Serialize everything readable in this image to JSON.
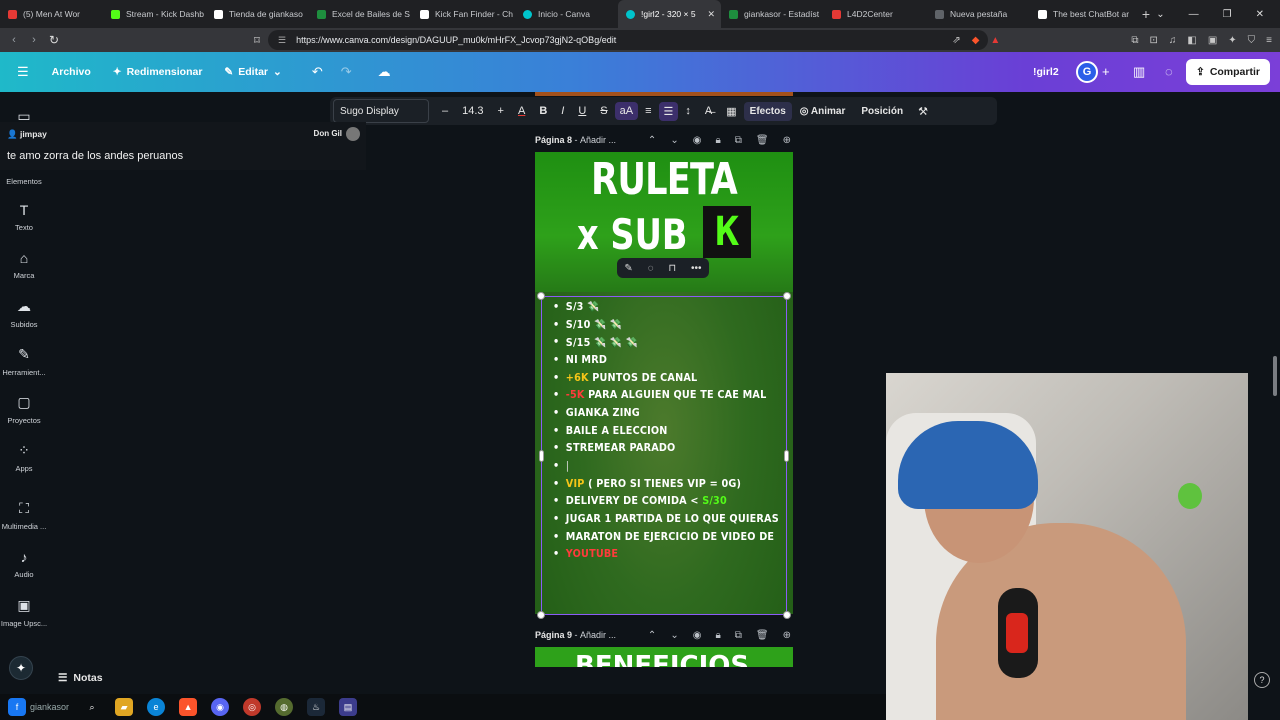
{
  "browser": {
    "tabs": [
      {
        "label": "(5) Men At Wor",
        "color": "#e53935"
      },
      {
        "label": "Stream - Kick Dashb",
        "color": "#53fc18"
      },
      {
        "label": "Tienda de giankaso",
        "color": "#ffffff"
      },
      {
        "label": "Excel de Bailes de S",
        "color": "#1e8e3e"
      },
      {
        "label": "Kick Fan Finder - Ch",
        "color": "#ffffff"
      },
      {
        "label": "Inicio - Canva",
        "color": "#00c4cc"
      },
      {
        "label": "!girl2 - 320 × 5",
        "color": "#00c4cc",
        "active": true
      },
      {
        "label": "giankasor - Estadíst",
        "color": "#1e8e3e"
      },
      {
        "label": "L4D2Center",
        "color": "#e53935"
      },
      {
        "label": "Nueva pestaña",
        "color": "#5f6368"
      },
      {
        "label": "The best ChatBot ar",
        "color": "#ffffff"
      }
    ],
    "url": "https://www.canva.com/design/DAGUUP_mu0k/mHrFX_Jcvop73gjN2-qOBg/edit"
  },
  "canva_header": {
    "archivo": "Archivo",
    "redimensionar": "Redimensionar",
    "editar": "Editar",
    "design_name": "!girl2",
    "avatar": "G",
    "share": "Compartir"
  },
  "toolbar": {
    "font": "Sugo Display",
    "font_size": "14.3",
    "efectos": "Efectos",
    "animar": "Animar",
    "posicion": "Posición"
  },
  "sidebar": {
    "items": [
      {
        "label": "Elementos",
        "icon": "shapes-icon"
      },
      {
        "label": "Texto",
        "icon": "text-icon"
      },
      {
        "label": "Marca",
        "icon": "brand-icon"
      },
      {
        "label": "Subidos",
        "icon": "upload-icon"
      },
      {
        "label": "Herramient...",
        "icon": "draw-icon"
      },
      {
        "label": "Proyectos",
        "icon": "folder-icon"
      },
      {
        "label": "Apps",
        "icon": "apps-icon"
      },
      {
        "label": "Multimedia ...",
        "icon": "media-icon"
      },
      {
        "label": "Audio",
        "icon": "audio-icon"
      },
      {
        "label": "Image Upsc...",
        "icon": "image-icon"
      }
    ]
  },
  "chat": {
    "user": "jimpay",
    "streamer": "Don Gil",
    "message": "te amo zorra de los andes peruanos"
  },
  "pages": {
    "page8_label": "Página 8",
    "page8_add": "Añadir ...",
    "page9_label": "Página 9",
    "page9_add": "Añadir ...",
    "page9_title": "BENEFICIOS"
  },
  "design": {
    "title_line1": "RULETA",
    "title_line2": "x SUB",
    "logo_letter": "K",
    "list": {
      "i1": "S/3 💸",
      "i2": "S/10 💸 💸",
      "i3": "S/15 💸 💸 💸",
      "i4": "NI MRD",
      "i5a": "+6K",
      "i5b": " PUNTOS DE CANAL",
      "i6a": "-5K",
      "i6b": " PARA ALGUIEN QUE TE CAE MAL",
      "i7": "GIANKA ZING",
      "i8": "BAILE A ELECCION",
      "i9": "STREMEAR PARADO",
      "i10": "",
      "i11a": "VIP",
      "i11b": " ( PERO SI TIENES VIP = 0G)",
      "i12a": "DELIVERY DE COMIDA < ",
      "i12b": "S/30",
      "i13": "JUGAR 1 PARTIDA DE LO QUE QUIERAS",
      "i14": "MARATON DE EJERCICIO DE VIDEO DE",
      "i15": "YOUTUBE"
    }
  },
  "bottom": {
    "notes": "Notas",
    "taskbar_app": "giankasor"
  }
}
